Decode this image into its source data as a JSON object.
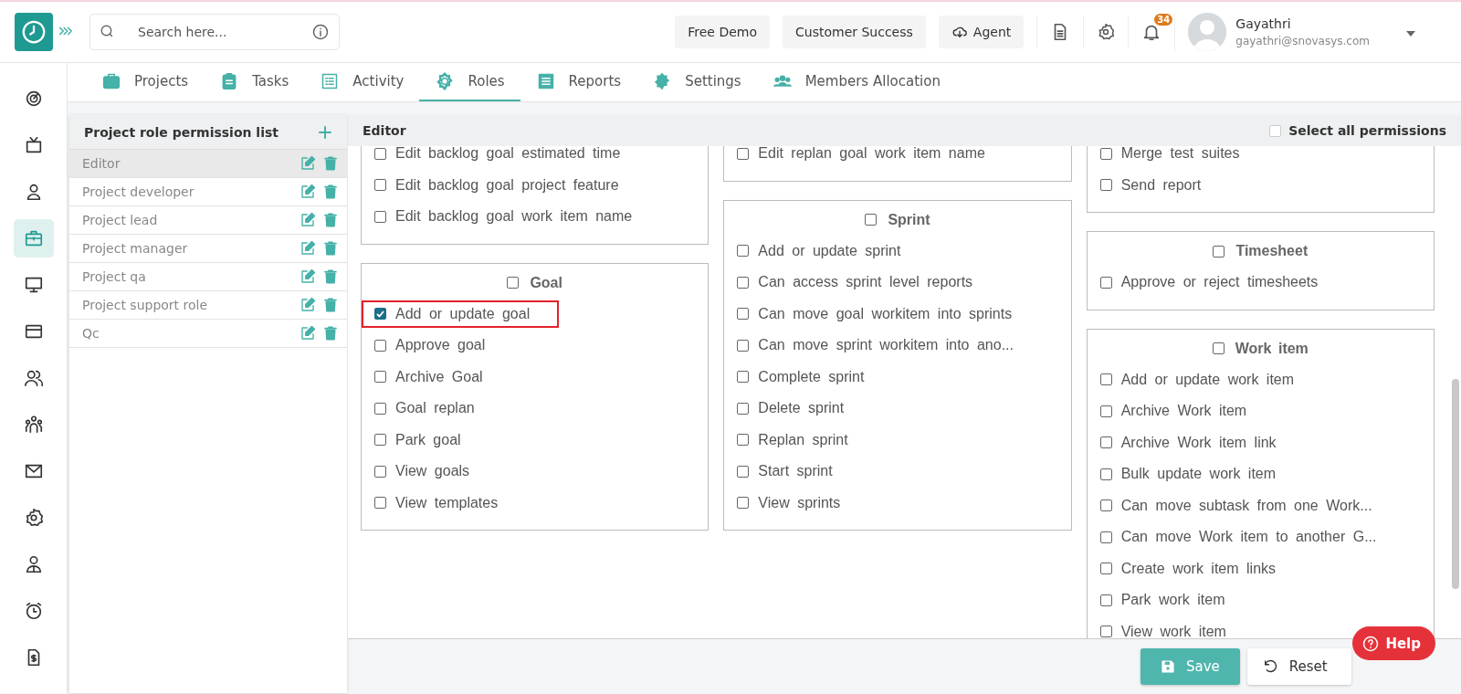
{
  "header": {
    "search": {
      "placeholder": "Search here..."
    },
    "buttons": [
      "Free Demo",
      "Customer Success",
      "Agent"
    ],
    "notifications": "34",
    "user": {
      "name": "Gayathri",
      "email": "gayathri@snovasys.com"
    }
  },
  "rail": [
    {
      "selected": false
    },
    {
      "selected": false
    },
    {
      "selected": false
    },
    {
      "selected": true
    },
    {
      "selected": false
    },
    {
      "selected": false
    },
    {
      "selected": false
    },
    {
      "selected": false
    },
    {
      "selected": false
    },
    {
      "selected": false
    },
    {
      "selected": false
    },
    {
      "selected": false
    },
    {
      "selected": false
    }
  ],
  "tabs": [
    {
      "label": "Projects",
      "selected": false
    },
    {
      "label": "Tasks",
      "selected": false
    },
    {
      "label": "Activity",
      "selected": false
    },
    {
      "label": "Roles",
      "selected": true
    },
    {
      "label": "Reports",
      "selected": false
    },
    {
      "label": "Settings",
      "selected": false
    },
    {
      "label": "Members Allocation",
      "selected": false
    }
  ],
  "role_list": {
    "title": "Project role permission list",
    "roles": [
      {
        "name": "Editor",
        "selected": true
      },
      {
        "name": "Project developer",
        "selected": false
      },
      {
        "name": "Project lead",
        "selected": false
      },
      {
        "name": "Project manager",
        "selected": false
      },
      {
        "name": "Project qa",
        "selected": false
      },
      {
        "name": "Project support role",
        "selected": false
      },
      {
        "name": "Qc",
        "selected": false
      }
    ]
  },
  "permissions": {
    "title": "Editor",
    "select_all": {
      "label": "Select all permissions",
      "checked": false
    },
    "columns": [
      [
        {
          "items": [
            {
              "label": "Edit backlog goal estimated time",
              "checked": false,
              "highlighted": false
            },
            {
              "label": "Edit backlog goal project feature",
              "checked": false,
              "highlighted": false
            },
            {
              "label": "Edit backlog goal work item name",
              "checked": false,
              "highlighted": false
            }
          ]
        },
        {
          "title": "Goal",
          "checked": false,
          "items": [
            {
              "label": "Add or update goal",
              "checked": true,
              "highlighted": true
            },
            {
              "label": "Approve goal",
              "checked": false,
              "highlighted": false
            },
            {
              "label": "Archive Goal",
              "checked": false,
              "highlighted": false
            },
            {
              "label": "Goal replan",
              "checked": false,
              "highlighted": false
            },
            {
              "label": "Park goal",
              "checked": false,
              "highlighted": false
            },
            {
              "label": "View goals",
              "checked": false,
              "highlighted": false
            },
            {
              "label": "View templates",
              "checked": false,
              "highlighted": false
            }
          ]
        }
      ],
      [
        {
          "items": [
            {
              "label": "Edit replan goal work item name",
              "checked": false,
              "highlighted": false
            }
          ]
        },
        {
          "title": "Sprint",
          "checked": false,
          "items": [
            {
              "label": "Add or update sprint",
              "checked": false,
              "highlighted": false
            },
            {
              "label": "Can access sprint level reports",
              "checked": false,
              "highlighted": false
            },
            {
              "label": "Can move goal workitem into sprints",
              "checked": false,
              "highlighted": false
            },
            {
              "label": "Can move sprint workitem into ano...",
              "checked": false,
              "highlighted": false
            },
            {
              "label": "Complete sprint",
              "checked": false,
              "highlighted": false
            },
            {
              "label": "Delete sprint",
              "checked": false,
              "highlighted": false
            },
            {
              "label": "Replan sprint",
              "checked": false,
              "highlighted": false
            },
            {
              "label": "Start sprint",
              "checked": false,
              "highlighted": false
            },
            {
              "label": "View sprints",
              "checked": false,
              "highlighted": false
            }
          ]
        }
      ],
      [
        {
          "items": [
            {
              "label": "Merge test suites",
              "checked": false,
              "highlighted": false
            },
            {
              "label": "Send report",
              "checked": false,
              "highlighted": false
            }
          ]
        },
        {
          "title": "Timesheet",
          "checked": false,
          "items": [
            {
              "label": "Approve or reject timesheets",
              "checked": false,
              "highlighted": false
            }
          ]
        },
        {
          "title": "Work item",
          "checked": false,
          "items": [
            {
              "label": "Add or update work item",
              "checked": false,
              "highlighted": false
            },
            {
              "label": "Archive Work item",
              "checked": false,
              "highlighted": false
            },
            {
              "label": "Archive Work item link",
              "checked": false,
              "highlighted": false
            },
            {
              "label": "Bulk update work item",
              "checked": false,
              "highlighted": false
            },
            {
              "label": "Can move subtask from one Work...",
              "checked": false,
              "highlighted": false
            },
            {
              "label": "Can move Work item to another G...",
              "checked": false,
              "highlighted": false
            },
            {
              "label": "Create work item links",
              "checked": false,
              "highlighted": false
            },
            {
              "label": "Park work item",
              "checked": false,
              "highlighted": false
            },
            {
              "label": "View work item",
              "checked": false,
              "highlighted": false
            }
          ]
        }
      ]
    ]
  },
  "footer": {
    "buttons": [
      {
        "label": "Save",
        "kind": "primary"
      },
      {
        "label": "Reset",
        "kind": "secondary"
      }
    ]
  },
  "help": "Help"
}
